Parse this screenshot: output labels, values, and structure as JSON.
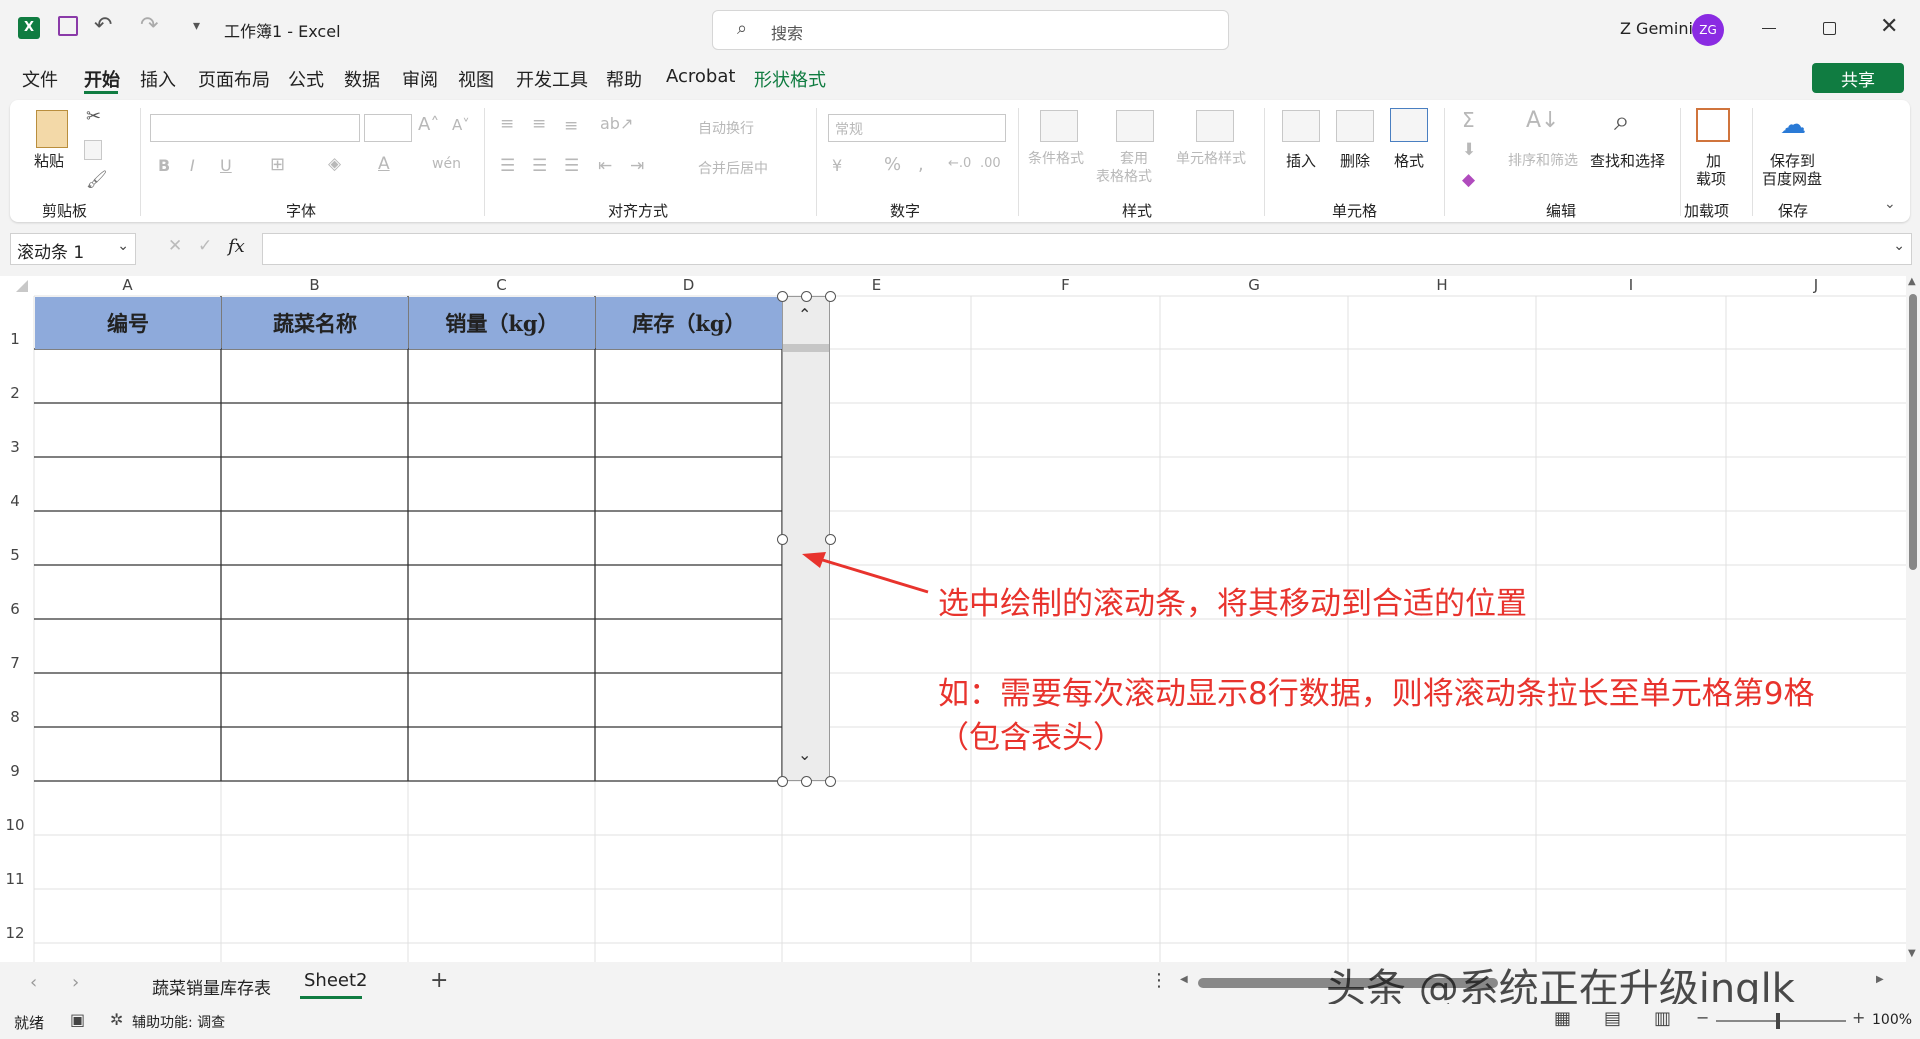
{
  "titlebar": {
    "doc_title": "工作簿1 - Excel",
    "search_placeholder": "搜索",
    "user_name": "Z Gemini",
    "avatar_initials": "ZG"
  },
  "menu": [
    "文件",
    "开始",
    "插入",
    "页面布局",
    "公式",
    "数据",
    "审阅",
    "视图",
    "开发工具",
    "帮助",
    "Acrobat",
    "形状格式"
  ],
  "share_label": "共享",
  "ribbon": {
    "paste": "粘贴",
    "clipboard": "剪贴板",
    "font": "字体",
    "wrap": "自动换行",
    "merge": "合并后居中",
    "alignment": "对齐方式",
    "number_format": "常规",
    "number": "数字",
    "cond_format": "条件格式",
    "table_format_1": "套用",
    "table_format_2": "表格格式",
    "cell_style": "单元格样式",
    "styles": "样式",
    "insert": "插入",
    "delete": "删除",
    "format": "格式",
    "cells": "单元格",
    "sort_filter": "排序和筛选",
    "find_select": "查找和选择",
    "editing": "编辑",
    "addin_1": "加",
    "addin_2": "载项",
    "addins": "加载项",
    "save_baidu_1": "保存到",
    "save_baidu_2": "百度网盘",
    "save": "保存"
  },
  "formula_bar": {
    "name_box": "滚动条 1",
    "fx": "fx",
    "value": ""
  },
  "columns": [
    "A",
    "B",
    "C",
    "D",
    "E",
    "F",
    "G",
    "H",
    "I",
    "J"
  ],
  "rows": [
    "1",
    "2",
    "3",
    "4",
    "5",
    "6",
    "7",
    "8",
    "9",
    "10",
    "11",
    "12"
  ],
  "table_headers": [
    "编号",
    "蔬菜名称",
    "销量（kg）",
    "库存（kg）"
  ],
  "annotation": {
    "line1": "选中绘制的滚动条，将其移动到合适的位置",
    "line2": "如：需要每次滚动显示8行数据，则将滚动条拉长至单元格第9格",
    "line3": "（包含表头）"
  },
  "sheets": [
    "蔬菜销量库存表",
    "Sheet2"
  ],
  "active_sheet": "Sheet2",
  "status": {
    "ready": "就绪",
    "accessibility": "辅助功能: 调查",
    "zoom": "100%"
  },
  "watermark": "头条 @系统正在升级inglk",
  "colors": {
    "excel_green": "#107c41",
    "header_fill": "#8eaadb",
    "annotation_red": "#e8332d"
  }
}
